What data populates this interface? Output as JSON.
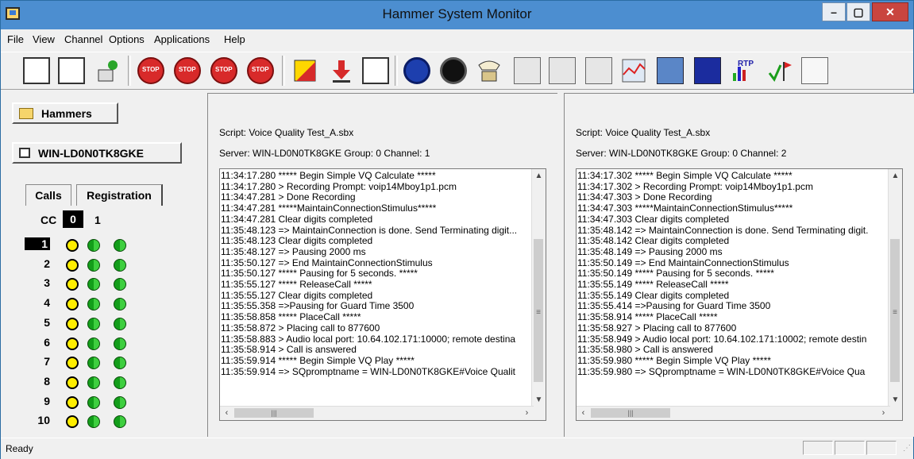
{
  "window": {
    "title": "Hammer System Monitor",
    "controls": [
      "–",
      "▢",
      "✕"
    ]
  },
  "menu": [
    "File",
    "View",
    "Channel",
    "Options",
    "Applications",
    "Help"
  ],
  "toolbar": {
    "icons": [
      "layout-1-icon",
      "layout-2-icon",
      "wizard-icon",
      "stop-1-icon",
      "stop-2-icon",
      "stop-3-icon",
      "stop-4-icon",
      "script-icon",
      "download-icon",
      "grid-icon",
      "blue-phone-icon",
      "black-phone-icon",
      "telephone-icon",
      "window-icon",
      "reports-icon",
      "print-icon",
      "chart-icon",
      "monitor-icon",
      "qoe-icon",
      "rtp-icon",
      "flag-icon",
      "form-icon"
    ]
  },
  "left": {
    "hammers_label": "Hammers",
    "server_label": "WIN-LD0N0TK8GKE",
    "tab_calls": "Calls",
    "tab_registration": "Registration",
    "cc_label": "CC",
    "cc_col0": "0",
    "cc_col1": "1",
    "rows": [
      "1",
      "2",
      "3",
      "4",
      "5",
      "6",
      "7",
      "8",
      "9",
      "10"
    ]
  },
  "channels": [
    {
      "script": "Script: Voice Quality Test_A.sbx",
      "server": "Server: WIN-LD0N0TK8GKE    Group: 0    Channel: 1",
      "log": [
        "11:34:17.280 ***** Begin Simple VQ Calculate *****",
        "11:34:17.280 > Recording Prompt: voip14Mboy1p1.pcm",
        "11:34:47.281 > Done Recording",
        "11:34:47.281 *****MaintainConnectionStimulus*****",
        "11:34:47.281 Clear digits completed",
        "11:35:48.123 => MaintainConnection is done. Send Terminating digit...",
        "11:35:48.123 Clear digits completed",
        "11:35:48.127 => Pausing 2000 ms",
        "11:35:50.127 => End MaintainConnectionStimulus",
        "11:35:50.127 ***** Pausing for 5 seconds. *****",
        "11:35:55.127 ***** ReleaseCall *****",
        "11:35:55.127 Clear digits completed",
        "11:35:55.358 =>Pausing for Guard Time  3500",
        "11:35:58.858 ***** PlaceCall  *****",
        "11:35:58.872 > Placing call to 877600",
        "11:35:58.883 > Audio local port: 10.64.102.171:10000; remote destina",
        "11:35:58.914 > Call is answered",
        "11:35:59.914 ***** Begin Simple VQ Play *****",
        "11:35:59.914 => SQpromptname = WIN-LD0N0TK8GKE#Voice Qualit"
      ]
    },
    {
      "script": "Script: Voice Quality Test_A.sbx",
      "server": "Server: WIN-LD0N0TK8GKE    Group: 0    Channel: 2",
      "log": [
        "11:34:17.302 ***** Begin Simple VQ Calculate *****",
        "11:34:17.302 > Recording Prompt: voip14Mboy1p1.pcm",
        "11:34:47.303 > Done Recording",
        "11:34:47.303 *****MaintainConnectionStimulus*****",
        "11:34:47.303 Clear digits completed",
        "11:35:48.142 => MaintainConnection is done. Send Terminating digit.",
        "11:35:48.142 Clear digits completed",
        "11:35:48.149 => Pausing 2000 ms",
        "11:35:50.149 => End MaintainConnectionStimulus",
        "11:35:50.149 ***** Pausing for 5 seconds. *****",
        "11:35:55.149 ***** ReleaseCall *****",
        "11:35:55.149 Clear digits completed",
        "11:35:55.414 =>Pausing for Guard Time  3500",
        "11:35:58.914 ***** PlaceCall  *****",
        "11:35:58.927 > Placing call to 877600",
        "11:35:58.949 > Audio local port: 10.64.102.171:10002; remote destin",
        "11:35:58.980 > Call is answered",
        "11:35:59.980 ***** Begin Simple VQ Play *****",
        "11:35:59.980 => SQpromptname = WIN-LD0N0TK8GKE#Voice Qua"
      ]
    }
  ],
  "status": {
    "text": "Ready"
  }
}
